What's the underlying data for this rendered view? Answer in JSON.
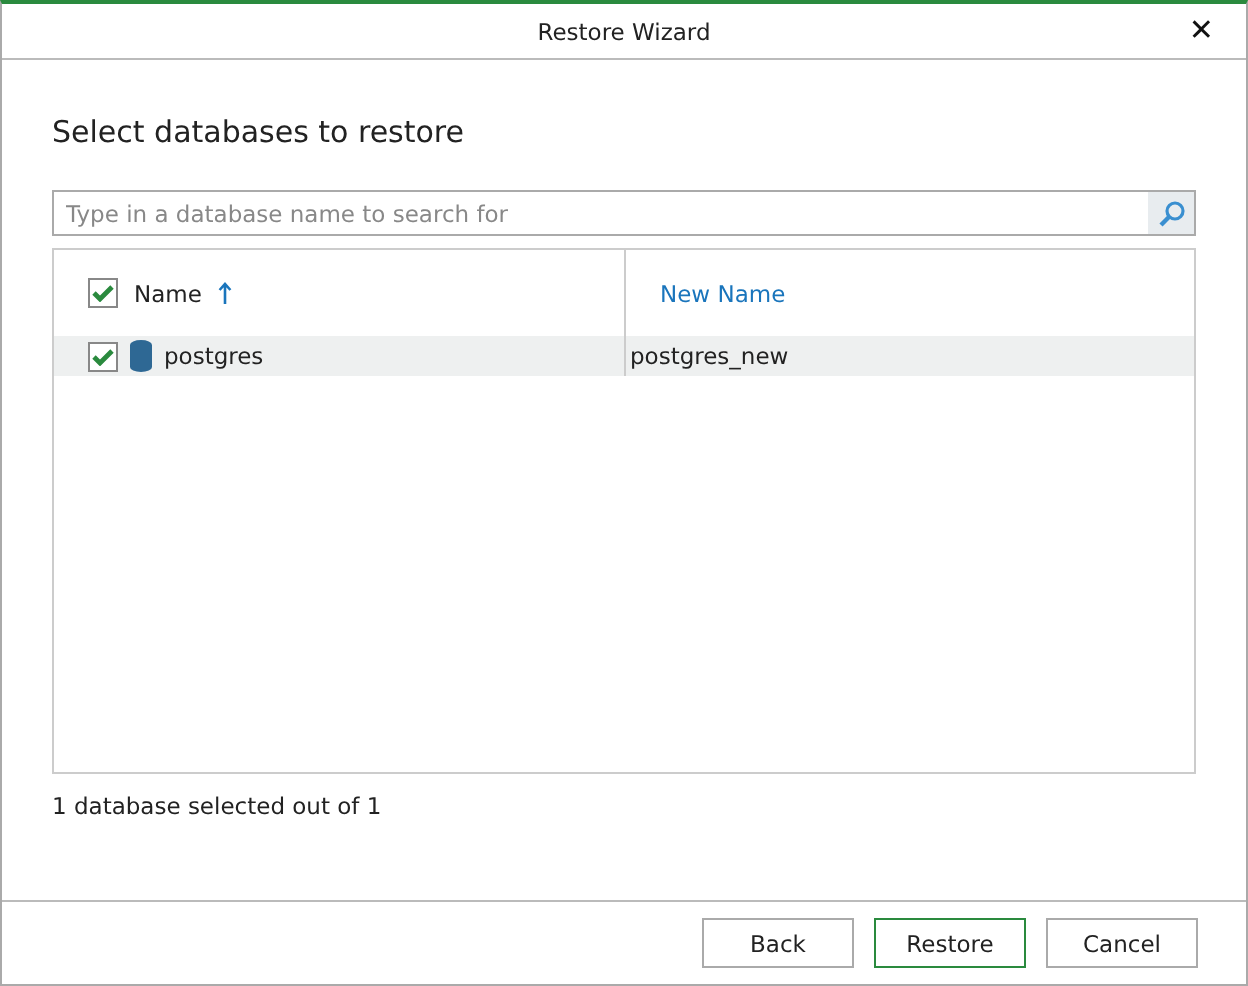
{
  "window": {
    "title": "Restore Wizard",
    "close": "✕"
  },
  "heading": "Select databases to restore",
  "search": {
    "placeholder": "Type in a database name to search for"
  },
  "table": {
    "select_all_checked": true,
    "columns": [
      {
        "label": "Name",
        "sorted": true
      },
      {
        "label": "New Name",
        "sorted": false
      }
    ],
    "rows": [
      {
        "checked": true,
        "selected": true,
        "name": "postgres",
        "new_name": "postgres_new"
      }
    ]
  },
  "status": "1 database selected out of 1",
  "buttons": [
    {
      "label": "Back",
      "default": false
    },
    {
      "label": "Restore",
      "default": true
    },
    {
      "label": "Cancel",
      "default": false
    }
  ]
}
